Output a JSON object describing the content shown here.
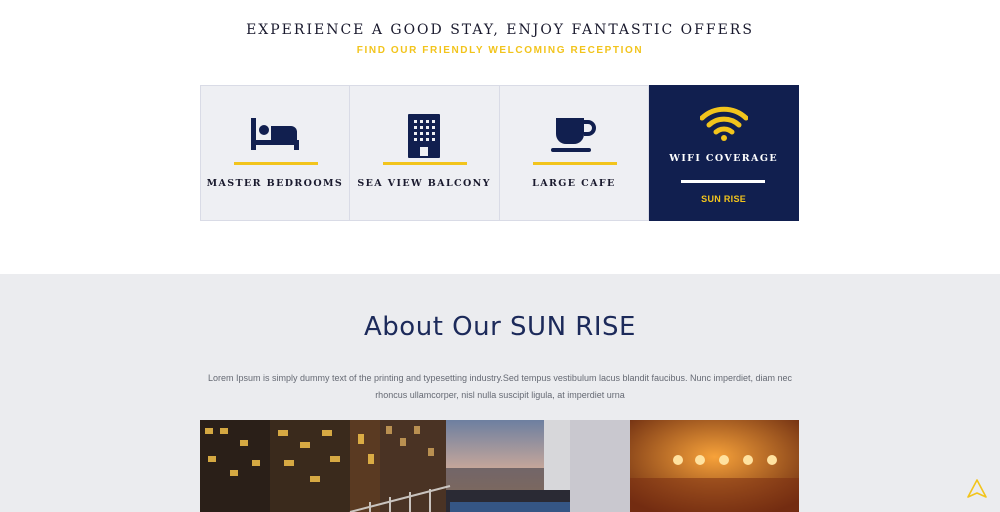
{
  "header": {
    "headline": "EXPERIENCE A GOOD STAY, ENJOY FANTASTIC OFFERS",
    "subline": "FIND OUR FRIENDLY WELCOMING RECEPTION"
  },
  "features": [
    {
      "label": "MASTER BEDROOMS",
      "icon": "bed-icon"
    },
    {
      "label": "SEA VIEW BALCONY",
      "icon": "building-icon"
    },
    {
      "label": "LARGE CAFE",
      "icon": "coffee-cup-icon"
    },
    {
      "label": "WIFI COVERAGE",
      "icon": "wifi-icon",
      "sublabel": "SUN RISE",
      "active": true
    }
  ],
  "about": {
    "title": "About Our SUN RISE",
    "text": "Lorem Ipsum is simply dummy text of the printing and typesetting industry.Sed tempus vestibulum lacus blandit faucibus. Nunc imperdiet, diam nec rhoncus ullamcorper, nisl nulla suscipit ligula, at imperdiet urna"
  },
  "colors": {
    "navy": "#111f4f",
    "accent": "#f2c41c",
    "panel": "#eeeff3"
  }
}
